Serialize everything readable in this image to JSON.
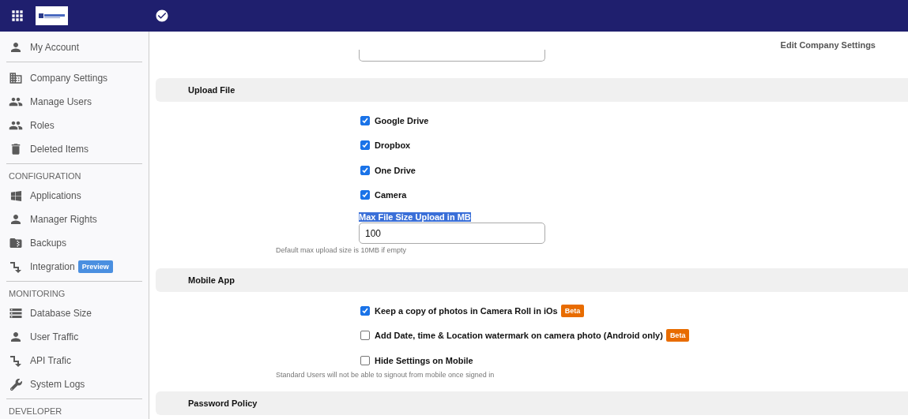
{
  "sidebar": {
    "sections": [
      {
        "items": [
          {
            "kind": "person",
            "label": "My Account",
            "selected": false
          }
        ]
      },
      {
        "items": [
          {
            "kind": "building",
            "label": "Company Settings",
            "selected": false
          },
          {
            "kind": "people",
            "label": "Manage Users",
            "selected": false
          },
          {
            "kind": "people",
            "label": "Roles",
            "selected": false
          },
          {
            "kind": "trash",
            "label": "Deleted Items",
            "selected": false
          }
        ]
      },
      {
        "header": "CONFIGURATION",
        "items": [
          {
            "kind": "windows",
            "label": "Applications",
            "selected": false
          },
          {
            "kind": "person",
            "label": "Manager Rights",
            "selected": false
          },
          {
            "kind": "zip",
            "label": "Backups",
            "selected": false
          },
          {
            "kind": "flow",
            "label": "Integration",
            "badge": "Preview",
            "selected": false
          }
        ]
      },
      {
        "header": "MONITORING",
        "items": [
          {
            "kind": "database",
            "label": "Database Size",
            "selected": false
          },
          {
            "kind": "person",
            "label": "User Traffic",
            "selected": false
          },
          {
            "kind": "flow",
            "label": "API Trafic",
            "selected": false
          },
          {
            "kind": "wrench",
            "label": "System Logs",
            "selected": false
          }
        ]
      },
      {
        "header": "DEVELOPER"
      }
    ]
  },
  "page_title": "Edit Company Settings",
  "sections": [
    {
      "rows": [
        {
          "kind": "cut-field"
        }
      ]
    },
    {
      "title": "Upload File",
      "rows": [
        {
          "kind": "checkbox",
          "label": "Google Drive",
          "checked": true
        },
        {
          "kind": "checkbox",
          "label": "Dropbox",
          "checked": true
        },
        {
          "kind": "checkbox",
          "label": "One Drive",
          "checked": true
        },
        {
          "kind": "checkbox",
          "label": "Camera",
          "checked": true
        },
        {
          "kind": "input",
          "label": "Max File Size Upload in MB",
          "label_highlighted": true,
          "value": "100",
          "hint": "Default max upload size is 10MB if empty"
        }
      ]
    },
    {
      "title": "Mobile App",
      "rows": [
        {
          "kind": "checkbox",
          "label": "Keep a copy of photos in Camera Roll in iOs",
          "checked": true,
          "badge": "Beta"
        },
        {
          "kind": "checkbox",
          "label": "Add Date, time & Location watermark on camera photo (Android only)",
          "checked": false,
          "badge": "Beta"
        },
        {
          "kind": "checkbox",
          "label": "Hide Settings on Mobile",
          "checked": false,
          "hint": "Standard Users will not be able to signout from mobile once signed in"
        }
      ]
    },
    {
      "title": "Password Policy"
    }
  ]
}
